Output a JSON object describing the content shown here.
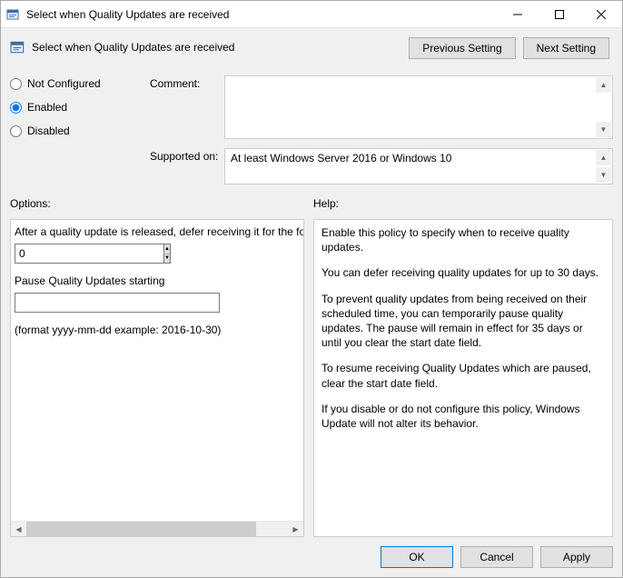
{
  "titlebar": {
    "title": "Select when Quality Updates are received"
  },
  "header": {
    "subtitle": "Select when Quality Updates are received",
    "prev": "Previous Setting",
    "next": "Next Setting"
  },
  "radios": {
    "not_configured": "Not Configured",
    "enabled": "Enabled",
    "disabled": "Disabled",
    "selected": "enabled"
  },
  "fields": {
    "comment_label": "Comment:",
    "comment_value": "",
    "supported_label": "Supported on:",
    "supported_value": "At least Windows Server 2016 or Windows 10"
  },
  "labels": {
    "options": "Options:",
    "help": "Help:"
  },
  "options": {
    "defer_label": "After a quality update is released, defer receiving it for the following number of days:",
    "defer_value": "0",
    "pause_label": "Pause Quality Updates starting",
    "pause_value": "",
    "format_hint": "(format yyyy-mm-dd example: 2016-10-30)"
  },
  "help": {
    "p1": "Enable this policy to specify when to receive quality updates.",
    "p2": "You can defer receiving quality updates for up to 30 days.",
    "p3": "To prevent quality updates from being received on their scheduled time, you can temporarily pause quality updates. The pause will remain in effect for 35 days or until you clear the start date field.",
    "p4": "To resume receiving Quality Updates which are paused, clear the start date field.",
    "p5": "If you disable or do not configure this policy, Windows Update will not alter its behavior."
  },
  "footer": {
    "ok": "OK",
    "cancel": "Cancel",
    "apply": "Apply"
  }
}
